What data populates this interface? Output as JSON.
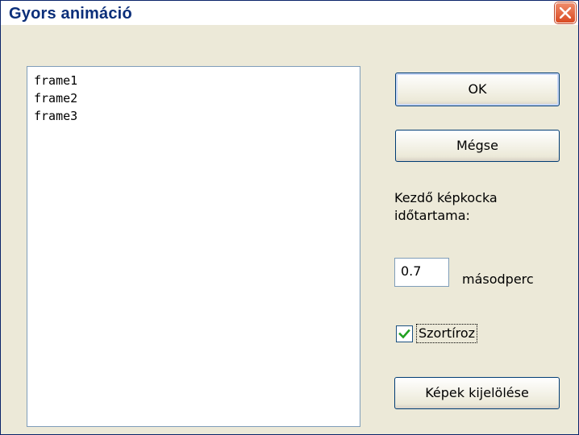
{
  "window": {
    "title": "Gyors animáció"
  },
  "titlebar": {
    "close_icon": "close-icon"
  },
  "frames": {
    "items": [
      "frame1",
      "frame2",
      "frame3"
    ]
  },
  "buttons": {
    "ok": "OK",
    "cancel": "Mégse",
    "select_images": "Képek kijelölése"
  },
  "duration": {
    "label_line1": "Kezdő képkocka",
    "label_line2": "időtartama:",
    "value": "0.7",
    "unit": "másodperc"
  },
  "sort": {
    "label": "Szortíroz",
    "checked": true
  },
  "colors": {
    "close_button": "#d94a22",
    "title_text": "#0b2f7a",
    "dialog_bg": "#ece9d8",
    "check_mark": "#21a121"
  }
}
